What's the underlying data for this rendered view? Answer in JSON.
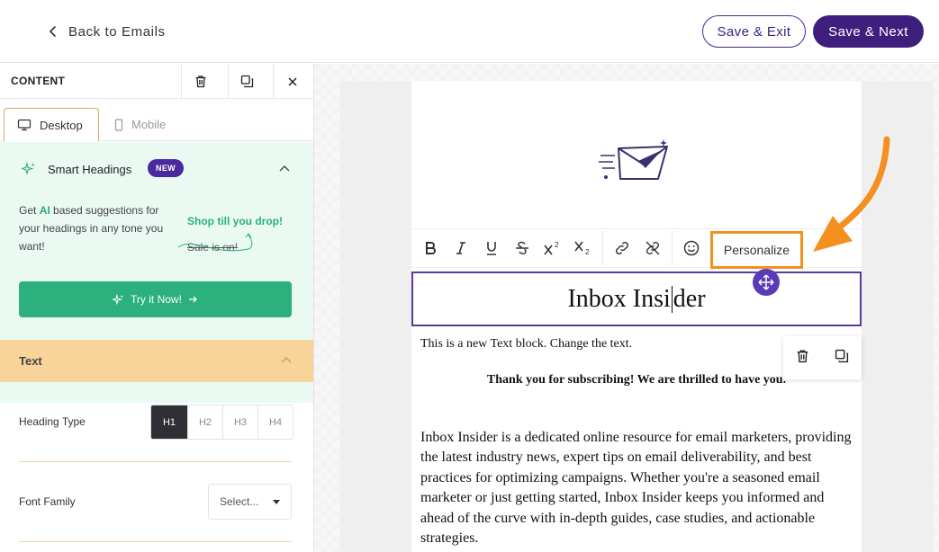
{
  "header": {
    "back_label": "Back to Emails",
    "save_exit_label": "Save & Exit",
    "save_next_label": "Save & Next"
  },
  "panel": {
    "title": "CONTENT",
    "tabs": [
      {
        "label": "Desktop",
        "icon": "desktop-icon",
        "active": true
      },
      {
        "label": "Mobile",
        "icon": "mobile-icon",
        "active": false
      }
    ],
    "smart_headings": {
      "title": "Smart Headings",
      "badge": "NEW",
      "desc_pre": "Get ",
      "desc_ai": "AI",
      "desc_post": " based suggestions for your headings in any tone you want!",
      "example_good": "Shop till you drop!",
      "example_bad": "Sale is on!",
      "try_label": "Try it Now!"
    },
    "text_section": {
      "title": "Text",
      "heading_type_label": "Heading Type",
      "heading_types": [
        "H1",
        "H2",
        "H3",
        "H4"
      ],
      "heading_type_selected": "H1",
      "font_family_label": "Font Family",
      "font_family_value": "Select..."
    }
  },
  "editor": {
    "toolbar": {
      "buttons": [
        "bold",
        "italic",
        "underline",
        "strikethrough",
        "superscript",
        "subscript",
        "link",
        "unlink",
        "emoji"
      ],
      "personalize_label": "Personalize"
    },
    "heading_pre": "Inbox Insi",
    "heading_post": "der",
    "text_block": "This is a new Text block. Change the text.",
    "thanks": "Thank you for subscribing! We are thrilled to have you.",
    "body": "Inbox Insider is a dedicated online resource for email marketers, providing the latest industry news, expert tips on email deliverability, and best practices for optimizing campaigns. Whether you're a seasoned email marketer or just getting started, Inbox Insider keeps you informed and ahead of the curve with in-depth guides, case studies, and actionable strategies."
  },
  "colors": {
    "brand_purple": "#3e1f7e",
    "accent_green": "#2bb07e",
    "highlight_orange": "#f3901f",
    "section_orange": "#f8d39a"
  }
}
